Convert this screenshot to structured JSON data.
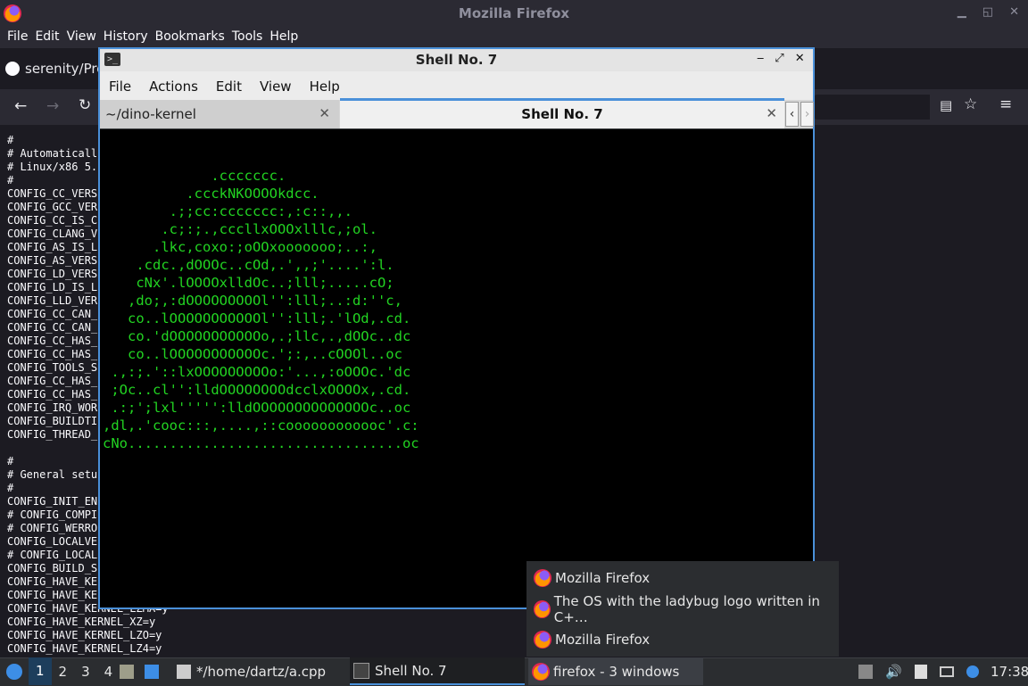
{
  "firefox": {
    "title": "Mozilla Firefox",
    "menu": [
      "File",
      "Edit",
      "View",
      "History",
      "Bookmarks",
      "Tools",
      "Help"
    ],
    "tab_label": "serenity/Pro",
    "code_lines": [
      "#",
      "# Automaticall",
      "# Linux/x86 5.",
      "#",
      "CONFIG_CC_VERS",
      "CONFIG_GCC_VER",
      "CONFIG_CC_IS_C",
      "CONFIG_CLANG_V",
      "CONFIG_AS_IS_L",
      "CONFIG_AS_VERS",
      "CONFIG_LD_VERS",
      "CONFIG_LD_IS_L",
      "CONFIG_LLD_VER",
      "CONFIG_CC_CAN_",
      "CONFIG_CC_CAN_",
      "CONFIG_CC_HAS_",
      "CONFIG_CC_HAS_",
      "CONFIG_TOOLS_S",
      "CONFIG_CC_HAS_",
      "CONFIG_CC_HAS_",
      "CONFIG_IRQ_WOR",
      "CONFIG_BUILDTI",
      "CONFIG_THREAD_",
      "",
      "#",
      "# General setu",
      "#",
      "CONFIG_INIT_EN",
      "# CONFIG_COMPI",
      "# CONFIG_WERRO",
      "CONFIG_LOCALVE",
      "# CONFIG_LOCAL",
      "CONFIG_BUILD_S",
      "CONFIG_HAVE_KE",
      "CONFIG_HAVE_KE",
      "CONFIG_HAVE_KERNEL_LZMA=y",
      "CONFIG_HAVE_KERNEL_XZ=y",
      "CONFIG_HAVE_KERNEL_LZO=y",
      "CONFIG_HAVE_KERNEL_LZ4=y"
    ]
  },
  "terminal": {
    "title": "Shell No. 7",
    "menu": [
      "File",
      "Actions",
      "Edit",
      "View",
      "Help"
    ],
    "tabs": [
      {
        "label": "~/dino-kernel",
        "active": false
      },
      {
        "label": "Shell No. 7",
        "active": true
      }
    ],
    "ascii_lines": [
      "             .ccccccc.",
      "          .ccckNKOOOOkdcc.",
      "        .;;cc:ccccccc:,:c::,,.",
      "       .c;:;.,cccllxOOOxlllc,;ol.",
      "      .lkc,coxo:;oOOxooooooo;..:,",
      "    .cdc.,dOOOc..cOd,.',,;'....':l.",
      "    cNx'.lOOOOxlldOc..;lll;.....cO;",
      "   ,do;,:dOOOOOOOOOl'':lll;..:d:''c,",
      "   co..lOOOOOOOOOOOl'':lll;.'lOd,.cd.",
      "   co.'dOOOOOOOOOOOo,.;llc,.,dOOc..dc",
      "   co..lOOOOOOOOOOOc.';:,..cOOOl..oc",
      " .,:;.'::lxOOOOOOOOOo:'...,:oOOOc.'dc",
      " ;Oc..cl'':lldOOOOOOOOdcclxOOOOx,.cd.",
      " .:;';lxl''''':lldOOOOOOOOOOOOOOc..oc",
      ",dl,.'cooc:::,....,::coooooooooooc'.c:",
      "cNo.................................oc"
    ]
  },
  "popup": {
    "items": [
      "Mozilla Firefox",
      "The OS with the ladybug logo written in C+…",
      "Mozilla Firefox"
    ]
  },
  "taskbar": {
    "workspaces": [
      "1",
      "2",
      "3",
      "4"
    ],
    "tasks": [
      "*/home/dartz/a.cpp",
      "Shell No. 7",
      "firefox - 3 windows"
    ],
    "clock": "17:38"
  }
}
